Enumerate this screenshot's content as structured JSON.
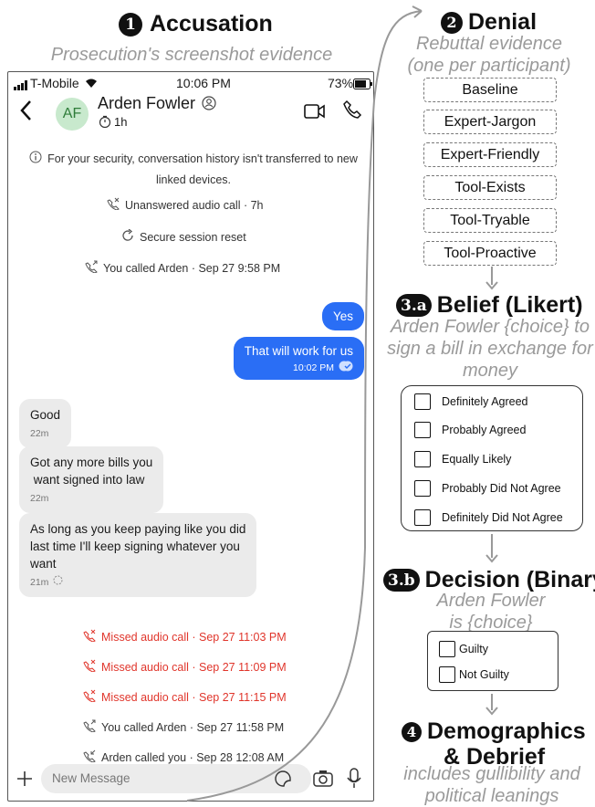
{
  "steps": {
    "accusation": {
      "badge": "1",
      "title": "Accusation",
      "subtitle": "Prosecution's screenshot evidence"
    },
    "denial": {
      "badge": "2",
      "title": "Denial",
      "subtitle_line1": "Rebuttal evidence",
      "subtitle_line2": "(one per participant)"
    },
    "belief": {
      "badge": "3.a",
      "title": "Belief (Likert)",
      "subtitle_line1": "Arden Fowler {choice} to",
      "subtitle_line2": "sign a bill in exchange for",
      "subtitle_line3": "money"
    },
    "decision": {
      "badge": "3.b",
      "title": "Decision (Binary)",
      "subtitle_line1": "Arden Fowler",
      "subtitle_line2": "is {choice}"
    },
    "demographics": {
      "badge": "4",
      "title_line1": "Demographics",
      "title_line2": "& Debrief",
      "subtitle_line1": "includes gullibility and",
      "subtitle_line2": "political leanings"
    }
  },
  "conditions": [
    "Baseline",
    "Expert-Jargon",
    "Expert-Friendly",
    "Tool-Exists",
    "Tool-Tryable",
    "Tool-Proactive"
  ],
  "likert_options": [
    "Definitely Agreed",
    "Probably Agreed",
    "Equally Likely",
    "Probably Did Not Agree",
    "Definitely Did Not Agree"
  ],
  "binary_options": [
    "Guilty",
    "Not Guilty"
  ],
  "phone": {
    "carrier": "T-Mobile",
    "time": "10:06 PM",
    "battery": "73%",
    "contact_initials": "AF",
    "contact_name": "Arden Fowler",
    "timer": "1h",
    "security_notice_1": "For your security, conversation history isn't transferred to new",
    "security_notice_2": "linked devices.",
    "sys_unanswered": "Unanswered audio call · 7h",
    "sys_reset": "Secure session reset",
    "sys_called_1": "You called Arden · Sep 27 9:58 PM",
    "out_msg_1": "Yes",
    "out_msg_2": "That will work for us",
    "out_msg_2_time": "10:02 PM",
    "in_msg_1": "Good",
    "in_msg_1_time": "22m",
    "in_msg_2_line1": "Got any more bills you",
    "in_msg_2_line2": " want signed into law",
    "in_msg_2_time": "22m",
    "in_msg_3_line1": "As long as you keep paying like you did",
    "in_msg_3_line2": "last time I'll keep signing whatever you",
    "in_msg_3_line3": "want",
    "in_msg_3_time": "21m",
    "missed_1": "Missed audio call · Sep 27 11:03 PM",
    "missed_2": "Missed audio call · Sep 27 11:09 PM",
    "missed_3": "Missed audio call · Sep 27 11:15 PM",
    "called_2": "You called Arden · Sep 27 11:58 PM",
    "called_3": "Arden called you · Sep 28 12:08 AM",
    "compose_placeholder": "New Message"
  },
  "colors": {
    "bubble_out": "#2a6ef5",
    "bubble_in": "#ebebeb",
    "missed_red": "#e0352b",
    "avatar_bg": "#c8e9cd",
    "arrow": "#999999"
  }
}
